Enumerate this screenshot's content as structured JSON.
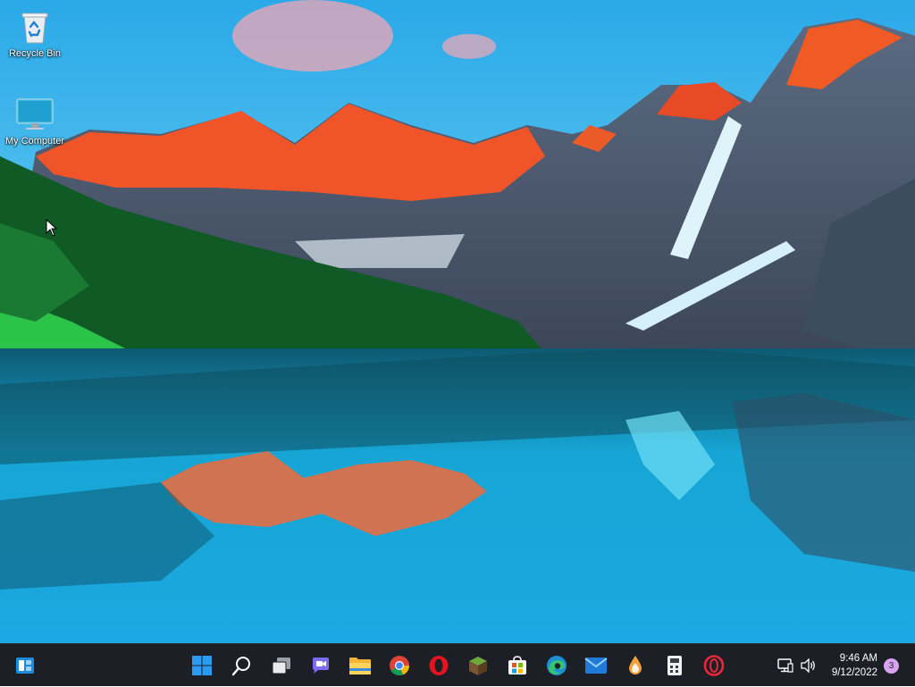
{
  "desktop": {
    "icons": [
      {
        "label": "Recycle Bin",
        "icon": "recycle-bin-icon"
      },
      {
        "label": "My Computer",
        "icon": "monitor-icon"
      }
    ]
  },
  "taskbar": {
    "widgets": {
      "icon": "widgets-icon"
    },
    "apps": [
      {
        "name": "Start",
        "icon": "windows-start-icon"
      },
      {
        "name": "Search",
        "icon": "search-icon"
      },
      {
        "name": "Task View",
        "icon": "task-view-icon"
      },
      {
        "name": "Chat",
        "icon": "chat-icon"
      },
      {
        "name": "File Explorer",
        "icon": "folder-icon"
      },
      {
        "name": "Chrome",
        "icon": "chrome-icon"
      },
      {
        "name": "Opera",
        "icon": "opera-icon"
      },
      {
        "name": "Minecraft",
        "icon": "cube-icon"
      },
      {
        "name": "Microsoft Store",
        "icon": "store-icon"
      },
      {
        "name": "Edge",
        "icon": "edge-icon"
      },
      {
        "name": "Mail",
        "icon": "mail-icon"
      },
      {
        "name": "Droplet app",
        "icon": "droplet-icon"
      },
      {
        "name": "Calculator app",
        "icon": "calculator-icon"
      },
      {
        "name": "Opera GX",
        "icon": "opera-gx-icon"
      }
    ],
    "tray": {
      "network_icon": "network-icon",
      "volume_icon": "volume-icon"
    },
    "clock": {
      "time": "9:46 AM",
      "date": "9/12/2022"
    },
    "notifications": {
      "count": "3"
    }
  }
}
